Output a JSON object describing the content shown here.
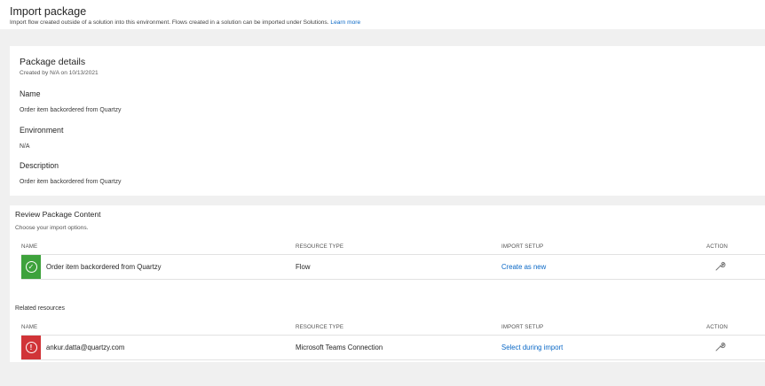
{
  "header": {
    "title": "Import package",
    "subtitle": "Import flow created outside of a solution into this environment. Flows created in a solution can be imported under Solutions.",
    "learn_more": "Learn more"
  },
  "details": {
    "title": "Package details",
    "created": "Created by N/A on 10/13/2021",
    "fields": [
      {
        "label": "Name",
        "value": "Order item backordered from Quartzy"
      },
      {
        "label": "Environment",
        "value": "N/A"
      },
      {
        "label": "Description",
        "value": "Order item backordered from Quartzy"
      }
    ]
  },
  "review": {
    "title": "Review Package Content",
    "subtitle": "Choose your import options.",
    "columns": {
      "name": "NAME",
      "resource_type": "RESOURCE TYPE",
      "import_setup": "IMPORT SETUP",
      "action": "ACTION"
    },
    "rows": [
      {
        "status": "success",
        "name": "Order item backordered from Quartzy",
        "resource_type": "Flow",
        "import_setup": "Create as new"
      }
    ],
    "related_title": "Related resources",
    "related_rows": [
      {
        "status": "error",
        "name": "ankur.datta@quartzy.com",
        "resource_type": "Microsoft Teams Connection",
        "import_setup": "Select during import"
      }
    ]
  },
  "colors": {
    "accent": "#0a68c6",
    "success": "#3ea23c",
    "error": "#d13438"
  }
}
